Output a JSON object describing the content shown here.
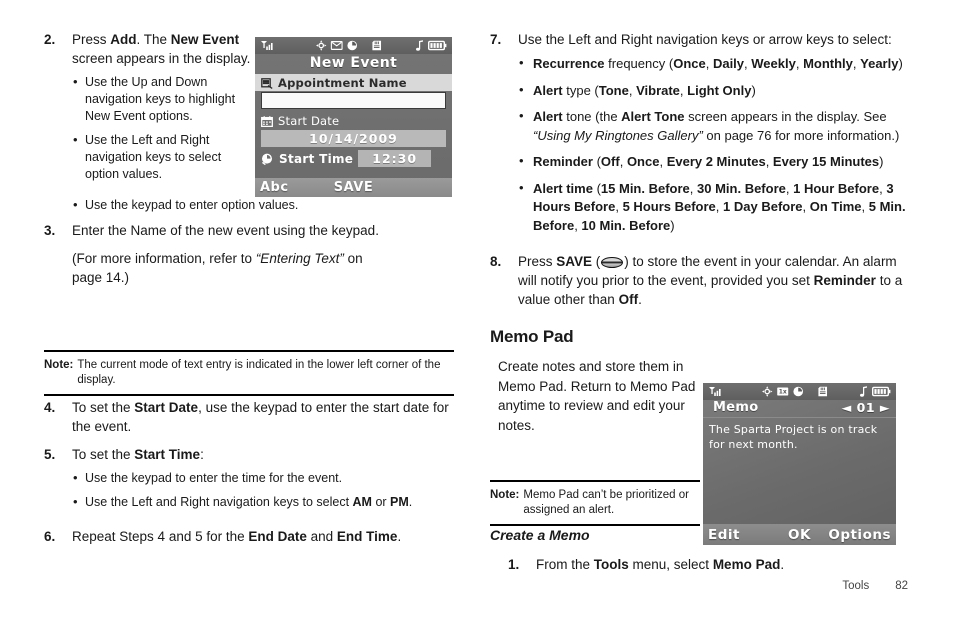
{
  "document": {
    "footer": {
      "section": "Tools",
      "page": "82"
    }
  },
  "left_column": {
    "step2": {
      "num": "2.",
      "text_html": "Press <b>Add</b>. The <b>New Event</b> screen appears in the display.",
      "bullets": [
        "Use the Up and Down navigation keys to highlight New Event options.",
        "Use the Left and Right navigation keys to select option values.",
        "Use the keypad to enter option values."
      ]
    },
    "step3": {
      "num": "3.",
      "line1_html": "Enter the Name of the new event using the keypad.",
      "line2_html": "(For more information, refer to <i>“Entering Text”</i> on page 14.)"
    },
    "note": {
      "label": "Note:",
      "text": "The current mode of text entry is indicated in the lower left corner of the display."
    },
    "step4": {
      "num": "4.",
      "text_html": "To set the <b>Start Date</b>, use the keypad to enter the start date for the event."
    },
    "step5": {
      "num": "5.",
      "text_html": "To set the <b>Start Time</b>:",
      "bullets_html": [
        "Use the keypad to enter the time for the event.",
        "Use the Left and Right navigation keys to select <b>AM</b> or <b>PM</b>."
      ]
    },
    "step6": {
      "num": "6.",
      "text_html": "Repeat Steps 4 and 5 for the <b>End Date</b> and <b>End Time</b>."
    }
  },
  "right_column": {
    "step7": {
      "num": "7.",
      "text_html": "Use the Left and Right navigation keys or arrow keys to select:",
      "bullets_html": [
        "<b>Recurrence</b> frequency (<b>Once</b>, <b>Daily</b>, <b>Weekly</b>, <b>Monthly</b>, <b>Yearly</b>)",
        "<b>Alert</b> type (<b>Tone</b>, <b>Vibrate</b>, <b>Light Only</b>)",
        "<b>Alert</b> tone (the <b>Alert Tone</b> screen appears in the display. See <i>“Using My Ringtones Gallery”</i> on page 76 for more information.)",
        "<b>Reminder</b> (<b>Off</b>, <b>Once</b>, <b>Every 2 Minutes</b>, <b>Every 15 Minutes</b>)",
        "<b>Alert time</b> (<b>15 Min. Before</b>, <b>30 Min. Before</b>, <b>1 Hour Before</b>, <b>3 Hours Before</b>, <b>5 Hours Before</b>, <b>1 Day Before</b>, <b>On Time</b>, <b>5 Min. Before</b>, <b>10 Min. Before</b>)"
      ]
    },
    "step8": {
      "num": "8.",
      "pre_html": "Press <b>SAVE</b> (",
      "post_html": ") to store the event in your calendar. An alarm will notify you prior to the event, provided you set <b>Reminder</b> to a value other than <b>Off</b>."
    },
    "memo_pad": {
      "heading": "Memo Pad",
      "paragraph": "Create notes and store them in Memo Pad. Return to Memo Pad anytime to review and edit your notes.",
      "note": {
        "label": "Note:",
        "text": "Memo Pad can’t be prioritized or assigned an alert."
      },
      "subheading": "Create a Memo",
      "step1": {
        "num": "1.",
        "text_html": "From the <b>Tools</b> menu, select <b>Memo Pad</b>."
      }
    }
  },
  "phone_screen_new_event": {
    "status_icons": [
      "signal-icon",
      "navigation-icon",
      "message-icon",
      "clock-icon",
      "memory-card-icon",
      "music-note-icon",
      "battery-icon"
    ],
    "title": "New Event",
    "fields": [
      {
        "icon": "note-icon",
        "label": "Appointment Name",
        "value": ""
      },
      {
        "icon": "calendar-icon",
        "label": "Start Date",
        "value": "10/14/2009"
      },
      {
        "icon": "alarm-clock-icon",
        "label": "Start Time",
        "value": "12:30"
      }
    ],
    "soft_keys": {
      "left": "Abc",
      "center": "SAVE",
      "right": ""
    }
  },
  "phone_screen_memo": {
    "status_icons": [
      "signal-icon",
      "navigation-icon",
      "1x-icon",
      "clock-icon",
      "memory-card-icon",
      "music-note-icon",
      "battery-icon"
    ],
    "title": "Memo",
    "index": "◄ 01 ►",
    "body": "The Sparta Project is on track for next month.",
    "soft_keys": {
      "left": "Edit",
      "center": "OK",
      "right": "Options"
    }
  }
}
